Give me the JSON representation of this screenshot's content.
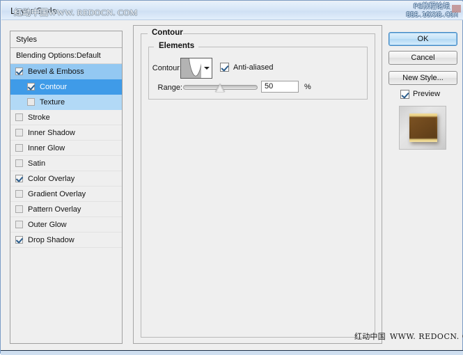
{
  "window": {
    "title": "Layer Style",
    "title_watermark_cn": "红动中国",
    "title_watermark_en": "WWW. REDOCN. COM",
    "corner_watermark_line1": "PS教程论坛",
    "corner_watermark_line2": "BBS.16XX8.COM"
  },
  "styles_panel": {
    "header": "Styles",
    "blending_options": "Blending Options:Default",
    "items": [
      {
        "label": "Bevel & Emboss",
        "checked": true,
        "selected": "light",
        "indent": false
      },
      {
        "label": "Contour",
        "checked": true,
        "selected": "strong",
        "indent": true
      },
      {
        "label": "Texture",
        "checked": false,
        "selected": "pale",
        "indent": true
      },
      {
        "label": "Stroke",
        "checked": false,
        "selected": "none",
        "indent": false
      },
      {
        "label": "Inner Shadow",
        "checked": false,
        "selected": "none",
        "indent": false
      },
      {
        "label": "Inner Glow",
        "checked": false,
        "selected": "none",
        "indent": false
      },
      {
        "label": "Satin",
        "checked": false,
        "selected": "none",
        "indent": false
      },
      {
        "label": "Color Overlay",
        "checked": true,
        "selected": "none",
        "indent": false
      },
      {
        "label": "Gradient Overlay",
        "checked": false,
        "selected": "none",
        "indent": false
      },
      {
        "label": "Pattern Overlay",
        "checked": false,
        "selected": "none",
        "indent": false
      },
      {
        "label": "Outer Glow",
        "checked": false,
        "selected": "none",
        "indent": false
      },
      {
        "label": "Drop Shadow",
        "checked": true,
        "selected": "none",
        "indent": false
      }
    ]
  },
  "contour_panel": {
    "group_title": "Contour",
    "elements_title": "Elements",
    "contour_label": "Contour:",
    "contour_preset": "Cone",
    "anti_aliased_label": "Anti-aliased",
    "anti_aliased_checked": true,
    "range_label": "Range:",
    "range_value": "50",
    "range_unit": "%",
    "range_percent": 50
  },
  "buttons": {
    "ok": "OK",
    "cancel": "Cancel",
    "new_style": "New Style...",
    "preview_label": "Preview",
    "preview_checked": true
  },
  "footer": {
    "watermark_cn": "红动中国",
    "watermark_en": "WWW. REDOCN. COM"
  },
  "colors": {
    "dialog_bg": "#efefef",
    "titlebar_blue": "#d7e6f7",
    "selection_strong": "#3f9be8",
    "selection_light": "#93c8f2",
    "selection_pale": "#b2d9f6",
    "ok_border": "#3f87c4",
    "preview_brown": "#6b461c",
    "preview_gold": "#f1dc9a"
  }
}
